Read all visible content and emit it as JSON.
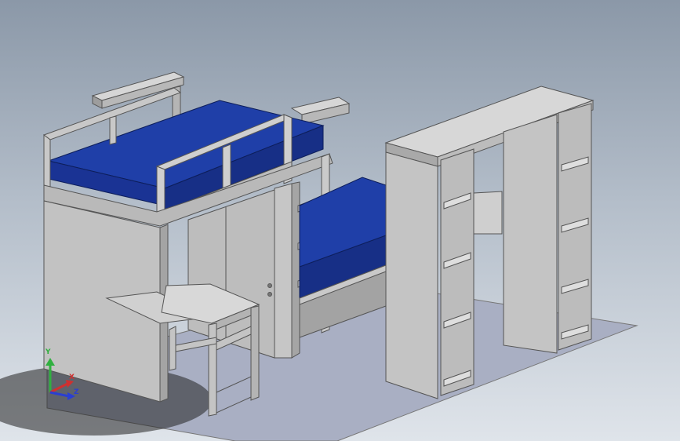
{
  "triad": {
    "y_label": "Y",
    "x_label": "X",
    "z_label": "Z"
  },
  "colors": {
    "background_top": "#8b98a8",
    "background_bottom": "#dfe4ea",
    "mattress_top": "#1f3fa8",
    "mattress_side": "#172f86",
    "frame_face": "#c4c4c4",
    "frame_light": "#d4d4d4",
    "frame_dark": "#9a9a9a",
    "floor": "#a9afc3",
    "axis_x": "#d03030",
    "axis_y": "#30b040",
    "axis_z": "#2b3fd0"
  }
}
